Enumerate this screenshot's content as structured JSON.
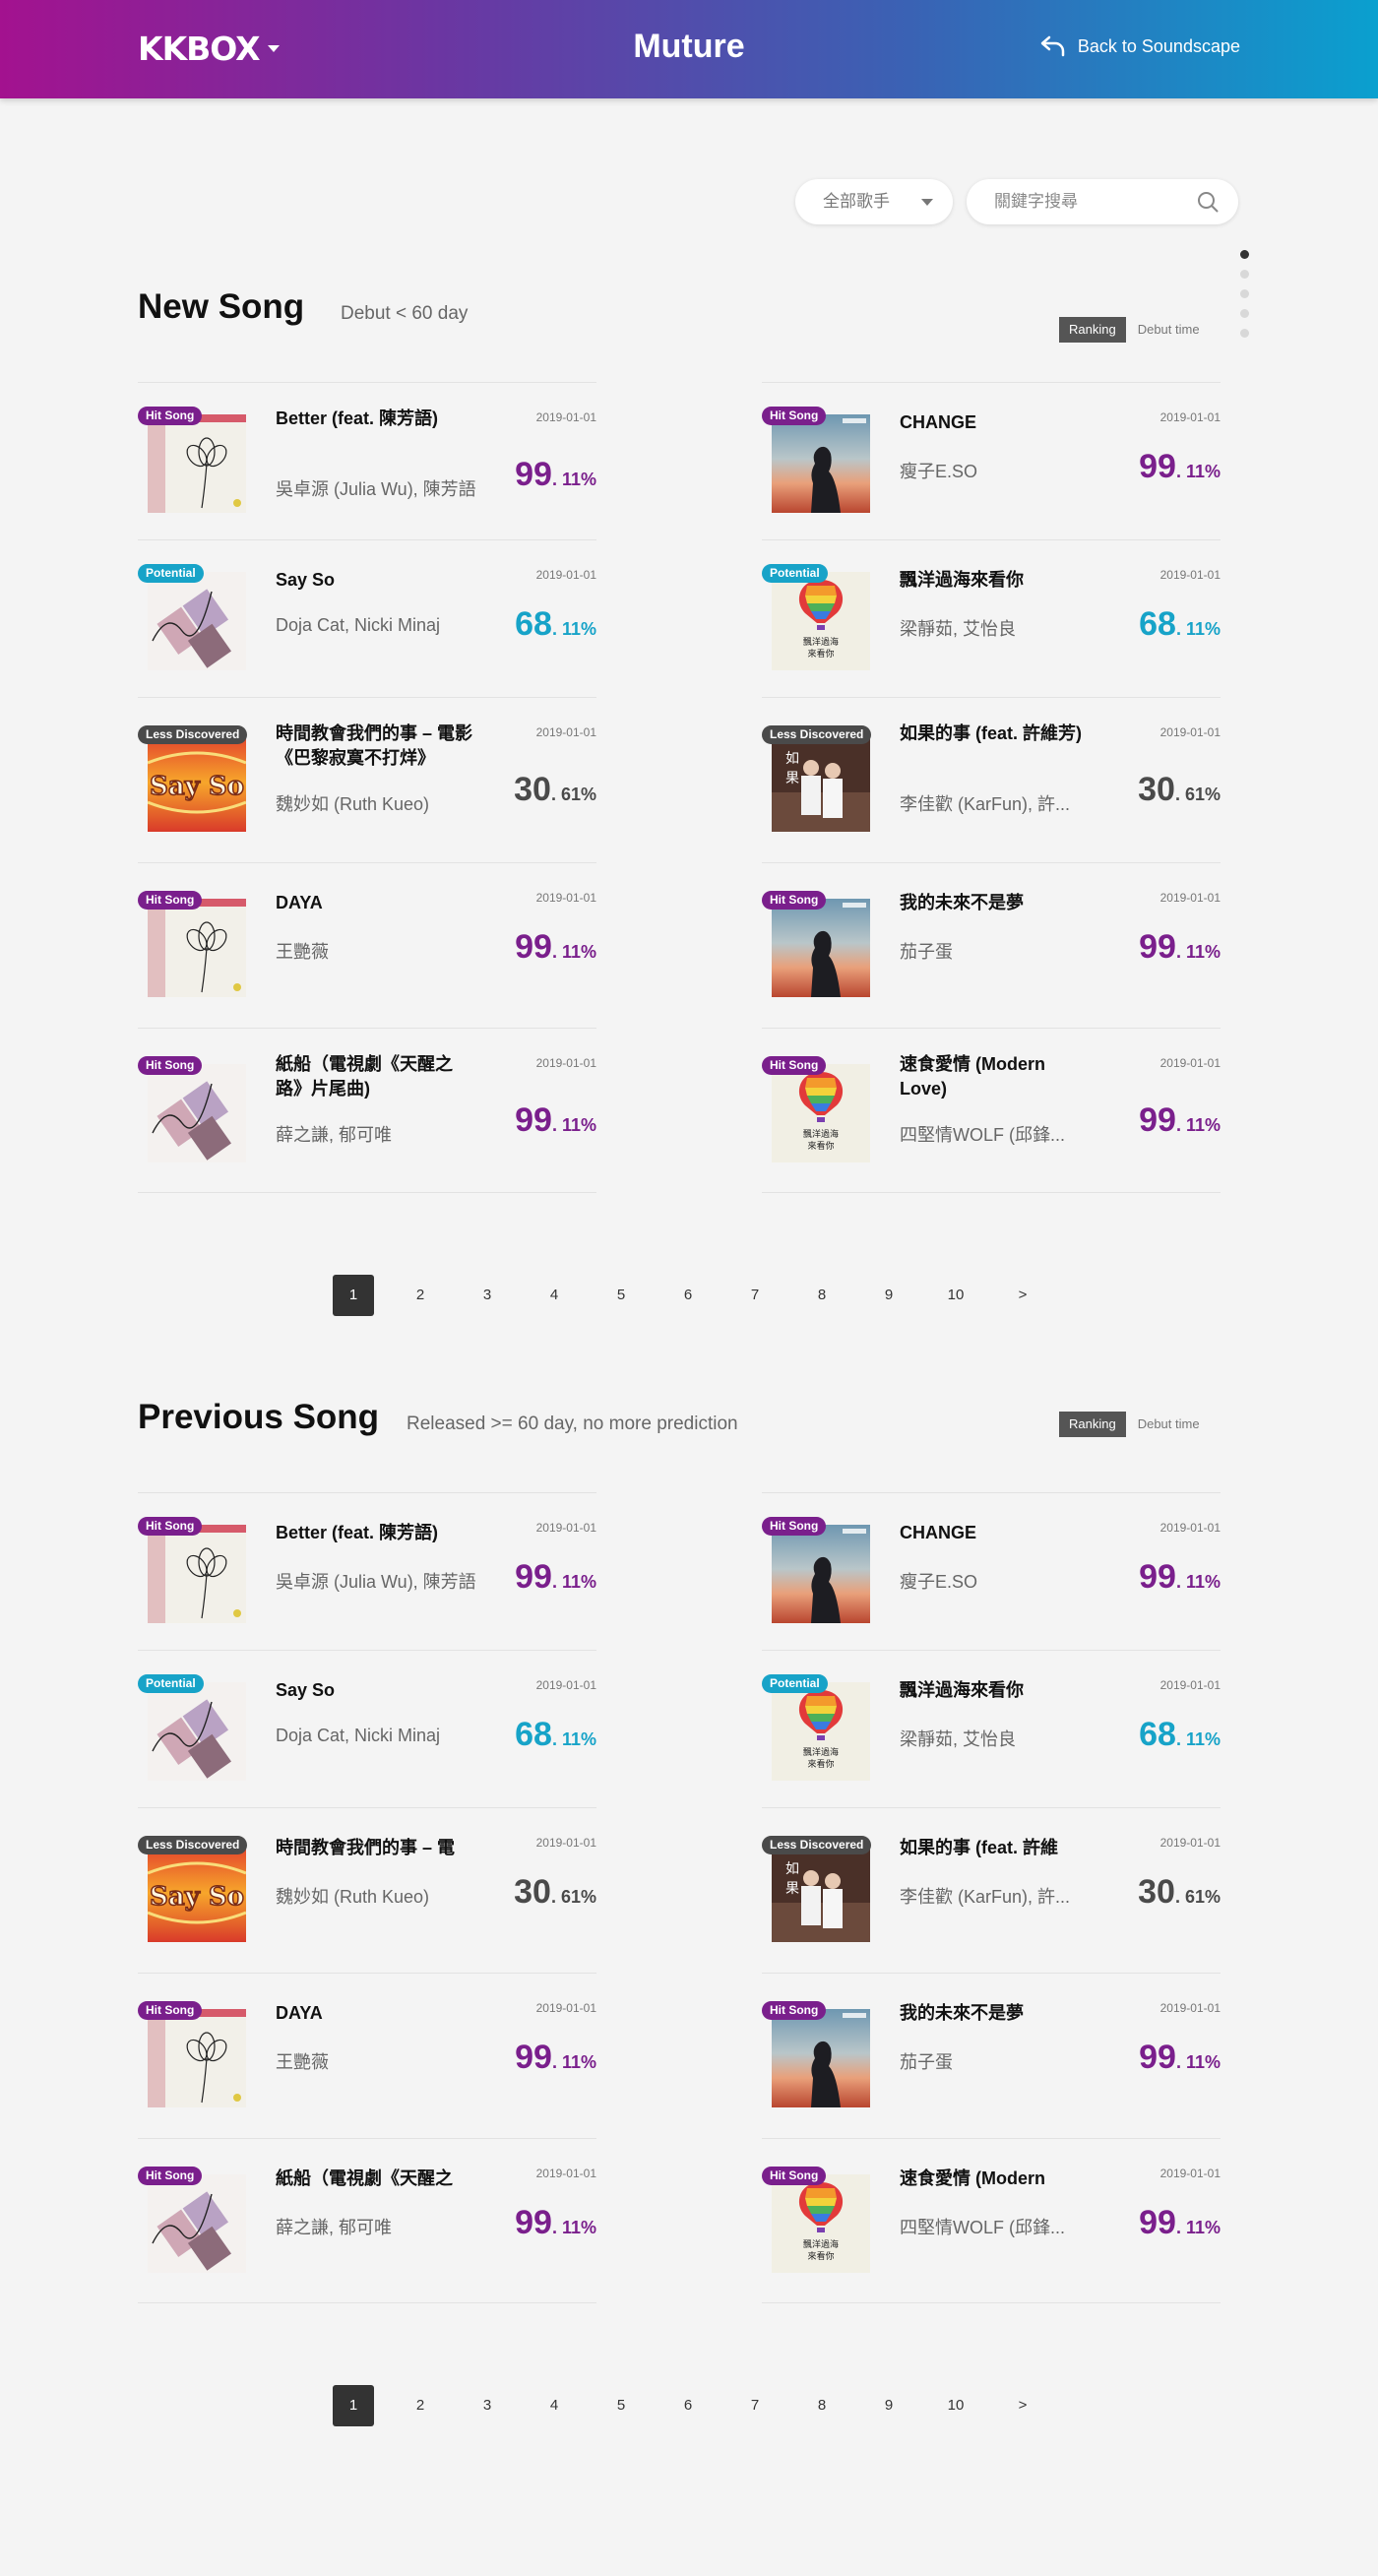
{
  "header": {
    "logo": "KKBOX",
    "title": "Muture",
    "back_label": "Back to Soundscape"
  },
  "filters": {
    "artist_select": "全部歌手",
    "search_placeholder": "關鍵字搜尋"
  },
  "sections": [
    {
      "title": "New Song",
      "subtitle": "Debut < 60 day",
      "toggle": {
        "ranking": "Ranking",
        "debut_time": "Debut time"
      },
      "songs": [
        {
          "tag": "Hit Song",
          "tag_type": "hit",
          "art": "flower",
          "title": "Better (feat. 陳芳語)",
          "artist": "吳卓源 (Julia Wu), 陳芳語",
          "date": "2019-01-01",
          "score_int": "99",
          "score_dec": ". 11%"
        },
        {
          "tag": "Hit Song",
          "tag_type": "hit",
          "art": "change",
          "title": "CHANGE",
          "artist": "瘦子E.SO",
          "date": "2019-01-01",
          "score_int": "99",
          "score_dec": ". 11%"
        },
        {
          "tag": "Potential",
          "tag_type": "potential",
          "art": "sayso",
          "title": "Say So",
          "artist": "Doja Cat, Nicki Minaj",
          "date": "2019-01-01",
          "score_int": "68",
          "score_dec": ". 11%"
        },
        {
          "tag": "Potential",
          "tag_type": "potential",
          "art": "balloon",
          "title": "飄洋過海來看你",
          "artist": "梁靜茹, 艾怡良",
          "date": "2019-01-01",
          "score_int": "68",
          "score_dec": ". 11%"
        },
        {
          "tag": "Less Discovered",
          "tag_type": "less",
          "art": "retro",
          "title": "時間教會我們的事 – 電影《巴黎寂寞不打烊》",
          "artist": "魏妙如 (Ruth Kueo)",
          "date": "2019-01-01",
          "score_int": "30",
          "score_dec": ". 61%"
        },
        {
          "tag": "Less Discovered",
          "tag_type": "less",
          "art": "couple",
          "title": "如果的事 (feat. 許維芳)",
          "artist": "李佳歡 (KarFun), 許...",
          "date": "2019-01-01",
          "score_int": "30",
          "score_dec": ". 61%"
        },
        {
          "tag": "Hit Song",
          "tag_type": "hit",
          "art": "flower",
          "title": "DAYA",
          "artist": "王艷薇",
          "date": "2019-01-01",
          "score_int": "99",
          "score_dec": ". 11%"
        },
        {
          "tag": "Hit Song",
          "tag_type": "hit",
          "art": "change",
          "title": "我的未來不是夢",
          "artist": "茄子蛋",
          "date": "2019-01-01",
          "score_int": "99",
          "score_dec": ". 11%"
        },
        {
          "tag": "Hit Song",
          "tag_type": "hit",
          "art": "sayso",
          "title": "紙船（電視劇《天醒之路》片尾曲)",
          "artist": "薛之謙, 郁可唯",
          "date": "2019-01-01",
          "score_int": "99",
          "score_dec": ". 11%"
        },
        {
          "tag": "Hit Song",
          "tag_type": "hit",
          "art": "balloon",
          "title": "速食愛情 (Modern Love)",
          "artist": "四堅情WOLF (邱鋒...",
          "date": "2019-01-01",
          "score_int": "99",
          "score_dec": ". 11%"
        }
      ],
      "pages": [
        "1",
        "2",
        "3",
        "4",
        "5",
        "6",
        "7",
        "8",
        "9",
        "10",
        ">"
      ]
    },
    {
      "title": "Previous Song",
      "subtitle": "Released >= 60 day, no more prediction",
      "toggle": {
        "ranking": "Ranking",
        "debut_time": "Debut time"
      },
      "songs": [
        {
          "tag": "Hit Song",
          "tag_type": "hit",
          "art": "flower",
          "title": "Better (feat. 陳芳語)",
          "artist": "吳卓源 (Julia Wu), 陳芳語",
          "date": "2019-01-01",
          "score_int": "99",
          "score_dec": ". 11%"
        },
        {
          "tag": "Hit Song",
          "tag_type": "hit",
          "art": "change",
          "title": "CHANGE",
          "artist": "瘦子E.SO",
          "date": "2019-01-01",
          "score_int": "99",
          "score_dec": ". 11%"
        },
        {
          "tag": "Potential",
          "tag_type": "potential",
          "art": "sayso",
          "title": "Say So",
          "artist": "Doja Cat, Nicki Minaj",
          "date": "2019-01-01",
          "score_int": "68",
          "score_dec": ". 11%"
        },
        {
          "tag": "Potential",
          "tag_type": "potential",
          "art": "balloon",
          "title": "飄洋過海來看你",
          "artist": "梁靜茹, 艾怡良",
          "date": "2019-01-01",
          "score_int": "68",
          "score_dec": ". 11%"
        },
        {
          "tag": "Less Discovered",
          "tag_type": "less",
          "art": "retro",
          "title": "時間教會我們的事 – 電",
          "artist": "魏妙如 (Ruth Kueo)",
          "date": "2019-01-01",
          "score_int": "30",
          "score_dec": ". 61%"
        },
        {
          "tag": "Less Discovered",
          "tag_type": "less",
          "art": "couple",
          "title": "如果的事 (feat. 許維",
          "artist": "李佳歡 (KarFun), 許...",
          "date": "2019-01-01",
          "score_int": "30",
          "score_dec": ". 61%"
        },
        {
          "tag": "Hit Song",
          "tag_type": "hit",
          "art": "flower",
          "title": "DAYA",
          "artist": "王艷薇",
          "date": "2019-01-01",
          "score_int": "99",
          "score_dec": ". 11%"
        },
        {
          "tag": "Hit Song",
          "tag_type": "hit",
          "art": "change",
          "title": "我的未來不是夢",
          "artist": "茄子蛋",
          "date": "2019-01-01",
          "score_int": "99",
          "score_dec": ". 11%"
        },
        {
          "tag": "Hit Song",
          "tag_type": "hit",
          "art": "sayso",
          "title": "紙船（電視劇《天醒之",
          "artist": "薛之謙, 郁可唯",
          "date": "2019-01-01",
          "score_int": "99",
          "score_dec": ". 11%"
        },
        {
          "tag": "Hit Song",
          "tag_type": "hit",
          "art": "balloon",
          "title": "速食愛情 (Modern",
          "artist": "四堅情WOLF (邱鋒...",
          "date": "2019-01-01",
          "score_int": "99",
          "score_dec": ". 11%"
        }
      ],
      "pages": [
        "1",
        "2",
        "3",
        "4",
        "5",
        "6",
        "7",
        "8",
        "9",
        "10",
        ">"
      ]
    }
  ],
  "colors": {
    "hit": "#7a1f8c",
    "potential": "#17a3c8",
    "less": "#4a4a4a",
    "header_start": "#a3128f",
    "header_end": "#0aa0cf"
  }
}
